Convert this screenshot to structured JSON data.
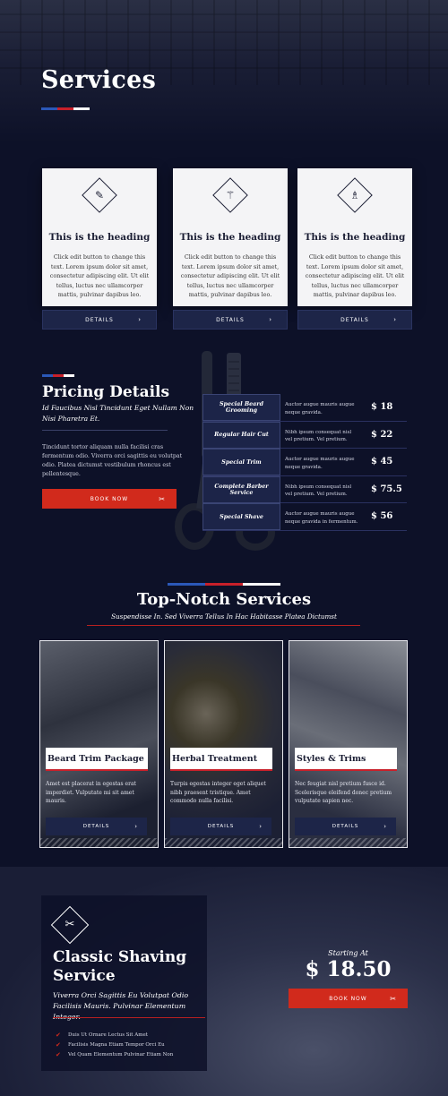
{
  "colors": {
    "background": "#0d1128",
    "accent_red": "#d12a1c",
    "accent_blue": "#2b58b8",
    "card_bg": "#f4f4f6",
    "button_navy": "#1d2548"
  },
  "hero": {
    "title": "Services"
  },
  "service_cards": [
    {
      "icon": "clipper-icon",
      "glyph": "✎",
      "heading": "This is the heading",
      "text": "Click edit button to change this text. Lorem ipsum dolor sit amet, consectetur adipiscing elit. Ut elit tellus, luctus nec ullamcorper mattis, pulvinar dapibus leo.",
      "button": "DETAILS"
    },
    {
      "icon": "barber-pole-icon",
      "glyph": "⚚",
      "heading": "This is the heading",
      "text": "Click edit button to change this text. Lorem ipsum dolor sit amet, consectetur adipiscing elit. Ut elit tellus, luctus nec ullamcorper mattis, pulvinar dapibus leo.",
      "button": "DETAILS"
    },
    {
      "icon": "barber-chair-icon",
      "glyph": "♗",
      "heading": "This is the heading",
      "text": "Click edit button to change this text. Lorem ipsum dolor sit amet, consectetur adipiscing elit. Ut elit tellus, luctus nec ullamcorper mattis, pulvinar dapibus leo.",
      "button": "DETAILS"
    }
  ],
  "pricing": {
    "title": "Pricing Details",
    "subtitle": "Id Faucibus Nisl Tincidunt Eget Nullam Non Nisi Pharetra Et.",
    "text": "Tincidunt tortor aliquam nulla facilisi cras fermentum odio. Viverra orci sagittis eu volutpat odio. Platea dictumst vestibulum rhoncus est pellentesque.",
    "button": "BOOK NOW",
    "items": [
      {
        "name": "Special Beard Grooming",
        "desc": "Auctor augue mauris augue neque gravida.",
        "price": "$ 18"
      },
      {
        "name": "Regular Hair Cut",
        "desc": "Nibh ipsum consequat nisl vel pretium. Vel pretium.",
        "price": "$ 22"
      },
      {
        "name": "Special Trim",
        "desc": "Auctor augue mauris augue neque gravida.",
        "price": "$ 45"
      },
      {
        "name": "Complete Barber Service",
        "desc": "Nibh ipsum consequat nisl vel pretium. Vel pretium.",
        "price": "$ 75.5"
      },
      {
        "name": "Special Shave",
        "desc": "Auctor augue mauris augue neque gravida in fermentum.",
        "price": "$ 56"
      }
    ]
  },
  "top_notch": {
    "title": "Top-Notch Services",
    "subtitle": "Suspendisse In. Sed Viverra Tellus In Hac Habitasse Platea Dictumst",
    "services": [
      {
        "title": "Beard Trim Package",
        "text": "Amet est placerat in egestas erat imperdiet. Vulputate mi sit amet mauris.",
        "button": "DETAILS"
      },
      {
        "title": "Herbal Treatment",
        "text": "Turpis egestas integer eget aliquet nibh praesent tristique. Amet commodo nulla facilisi.",
        "button": "DETAILS"
      },
      {
        "title": "Styles & Trims",
        "text": "Nec feugiat nisl pretium fusce id. Scelerisque eleifend donec pretium vulputate sapien nec.",
        "button": "DETAILS"
      }
    ]
  },
  "classic": {
    "title": "Classic Shaving Service",
    "subtitle": "Viverra Orci Sagittis Eu Volutpat Odio Facilisis Mauris. Pulvinar Elementum Integer.",
    "features": [
      "Duis Ut Ornare Lectus Sit Amet",
      "Facilisis Magna Etiam Tempor Orci Eu",
      "Vel Quam Elementum Pulvinar Etiam Non"
    ],
    "starting_label": "Starting At",
    "price": "$ 18.50",
    "button": "BOOK NOW"
  }
}
